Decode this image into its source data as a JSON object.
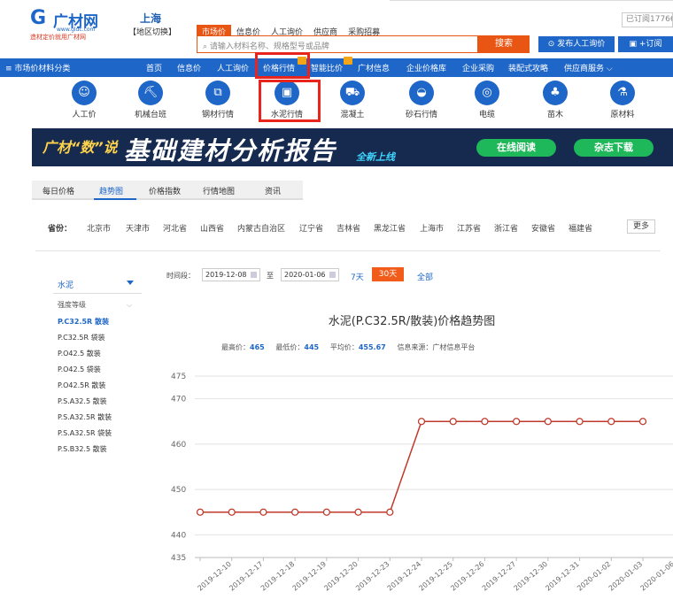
{
  "logo": {
    "mark": "G",
    "name": "广材网",
    "url": "www.gldc.com",
    "slogan": "造材定价就用广材网"
  },
  "location": {
    "city": "上海",
    "switch": "【地区切换】"
  },
  "top_tabs": [
    "市场价",
    "信息价",
    "人工询价",
    "供应商",
    "采购招募"
  ],
  "search": {
    "placeholder": "请输入材料名称、规格型号或品牌",
    "button": "搜索"
  },
  "publish_button": "⊙ 发布人工询价",
  "subscribe_button": "+订阅",
  "subscribed_label": "已订阅17766",
  "nav": {
    "category": "≡ 市场价材料分类",
    "items": [
      "首页",
      "信息价",
      "人工询价",
      "价格行情",
      "智能比价",
      "广材信息",
      "企业价格库",
      "企业采购",
      "装配式攻略",
      "供应商服务 ⌵"
    ]
  },
  "categories": [
    {
      "label": "人工价",
      "icon": "worker-icon"
    },
    {
      "label": "机械台班",
      "icon": "excavator-icon"
    },
    {
      "label": "钢材行情",
      "icon": "steel-icon"
    },
    {
      "label": "水泥行情",
      "icon": "cement-icon"
    },
    {
      "label": "混凝土",
      "icon": "mixer-truck-icon"
    },
    {
      "label": "砂石行情",
      "icon": "sand-icon"
    },
    {
      "label": "电缆",
      "icon": "cable-icon"
    },
    {
      "label": "苗木",
      "icon": "tree-icon"
    },
    {
      "label": "原材料",
      "icon": "raw-material-icon"
    }
  ],
  "banner": {
    "left": "广材“数”说",
    "title": "基础建材分析报告",
    "new": "全新上线",
    "read_button": "在线阅读",
    "download_button": "杂志下载"
  },
  "price_tabs": [
    "每日价格",
    "趋势图",
    "价格指数",
    "行情地图",
    "资讯"
  ],
  "province": {
    "label": "省份：",
    "items": [
      "北京市",
      "天津市",
      "河北省",
      "山西省",
      "内蒙古自治区",
      "辽宁省",
      "吉林省",
      "黑龙江省",
      "上海市",
      "江苏省",
      "浙江省",
      "安徽省",
      "福建省"
    ],
    "more": "更多"
  },
  "filter": {
    "material": "水泥",
    "grade_label": "强度等级",
    "grades": [
      "P.C32.5R 散装",
      "P.C32.5R 袋装",
      "P.O42.5 散装",
      "P.O42.5 袋装",
      "P.O42.5R 散装",
      "P.S.A32.5 散装",
      "P.S.A32.5R 散装",
      "P.S.A32.5R 袋装",
      "P.S.B32.5 散装"
    ],
    "selected": "P.C32.5R 散装"
  },
  "time_range": {
    "label": "时间段：",
    "start": "2019-12-08",
    "to": "至",
    "end": "2020-01-06",
    "r7": "7天",
    "r30": "30天",
    "all": "全部"
  },
  "chart_title": "水泥(P.C32.5R/散装)价格趋势图",
  "stats": {
    "max_label": "最高价：",
    "max": "465",
    "min_label": "最低价：",
    "min": "445",
    "avg_label": "平均价：",
    "avg": "455.67",
    "source": "信息来源：广材信息平台"
  },
  "colors": {
    "brand_blue": "#1e66c8",
    "accent_orange": "#e95513",
    "line": "#c0392b",
    "highlight_red": "#e8241c"
  },
  "chart_data": {
    "type": "line",
    "x": [
      "2019-12-10",
      "2019-12-17",
      "2019-12-18",
      "2019-12-19",
      "2019-12-20",
      "2019-12-23",
      "2019-12-24",
      "2019-12-25",
      "2019-12-26",
      "2019-12-27",
      "2019-12-30",
      "2019-12-31",
      "2020-01-02",
      "2020-01-03",
      "2020-01-06"
    ],
    "series": [
      {
        "values": [
          445,
          445,
          445,
          445,
          445,
          445,
          445,
          465,
          465,
          465,
          465,
          465,
          465,
          465,
          465
        ]
      }
    ],
    "yticks": [
      435,
      440,
      450,
      460,
      470,
      475
    ],
    "ylim": [
      435,
      475
    ],
    "grid": true
  }
}
